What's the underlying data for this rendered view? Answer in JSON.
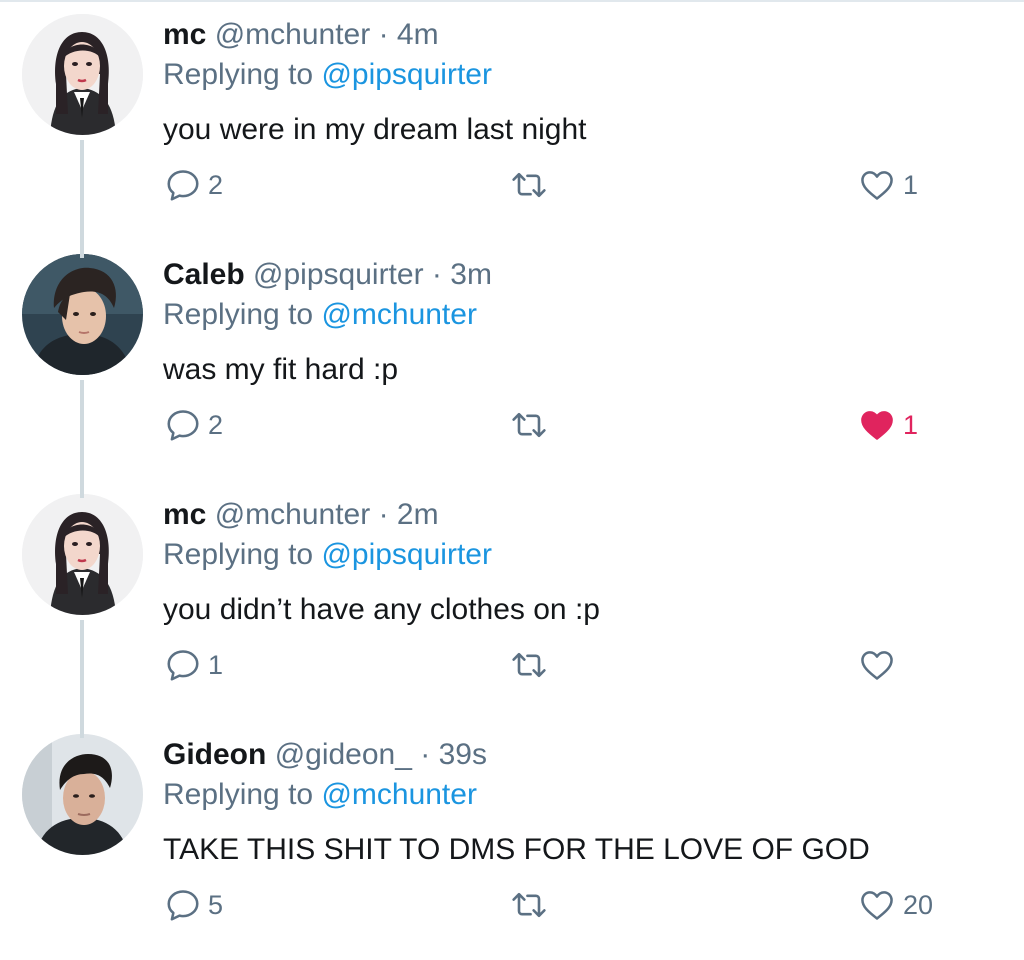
{
  "colors": {
    "name": "#14171a",
    "secondary": "#5b7083",
    "mention": "#1b95e0",
    "liked": "#e0245e",
    "thread_line": "#cfd9de"
  },
  "separator": "·",
  "reply_prefix": "Replying to",
  "tweets": [
    {
      "avatar": "mc-avatar",
      "name": "mc",
      "handle": "@mchunter",
      "time": "4m",
      "replying_to": "@pipsquirter",
      "text": "you were in my dream last night",
      "replies": "2",
      "retweets": "",
      "likes": "1",
      "liked": false
    },
    {
      "avatar": "caleb-avatar",
      "name": "Caleb",
      "handle": "@pipsquirter",
      "time": "3m",
      "replying_to": "@mchunter",
      "text": "was my fit hard :p",
      "replies": "2",
      "retweets": "",
      "likes": "1",
      "liked": true
    },
    {
      "avatar": "mc-avatar",
      "name": "mc",
      "handle": "@mchunter",
      "time": "2m",
      "replying_to": "@pipsquirter",
      "text": "you didn’t have any clothes on :p",
      "replies": "1",
      "retweets": "",
      "likes": "",
      "liked": false
    },
    {
      "avatar": "gideon-avatar",
      "name": "Gideon",
      "handle": "@gideon_",
      "time": "39s",
      "replying_to": "@mchunter",
      "text": "TAKE THIS SHIT TO DMS FOR THE LOVE OF GOD",
      "replies": "5",
      "retweets": "",
      "likes": "20",
      "liked": false
    }
  ]
}
